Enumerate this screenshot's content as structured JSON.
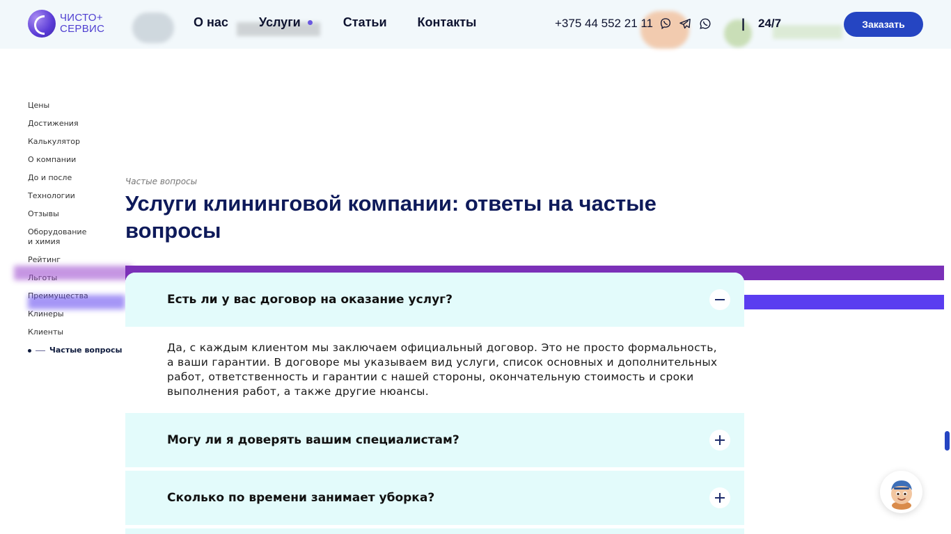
{
  "header": {
    "logo_line1": "ЧИСТО+",
    "logo_line2": "СЕРВИС",
    "nav": [
      {
        "label": "О нас"
      },
      {
        "label": "Услуги"
      },
      {
        "label": "Статьи"
      },
      {
        "label": "Контакты"
      }
    ],
    "phone": "+375 44 552 21 11",
    "separator": "|",
    "hours": "24/7",
    "order_button": "Заказать",
    "social_icons": [
      "viber-icon",
      "telegram-icon",
      "whatsapp-icon"
    ]
  },
  "sidebar": {
    "items": [
      {
        "label": "Цены"
      },
      {
        "label": "Достижения"
      },
      {
        "label": "Калькулятор"
      },
      {
        "label": "О компании"
      },
      {
        "label": "До и после"
      },
      {
        "label": "Технологии"
      },
      {
        "label": "Отзывы"
      },
      {
        "label": "Оборудование и химия"
      },
      {
        "label": "Рейтинг"
      },
      {
        "label": "Льготы"
      },
      {
        "label": "Преимущества"
      },
      {
        "label": "Клинеры"
      },
      {
        "label": "Клиенты"
      },
      {
        "label": "Частые вопросы",
        "active": true
      }
    ]
  },
  "main": {
    "eyebrow": "Частые вопросы",
    "title": "Услуги клининговой компании: ответы на частые вопросы",
    "faq": [
      {
        "question": "Есть ли у вас договор на оказание услуг?",
        "answer": "Да, с каждым клиентом мы заключаем официальный договор. Это не просто формальность, а ваши гарантии. В договоре мы указываем вид услуги, список основных и дополнительных работ, ответственность и гарантии с нашей стороны, окончательную стоимость и сроки выполнения работ, а также другие нюансы.",
        "expanded": true
      },
      {
        "question": "Могу ли я доверять вашим специалистам?",
        "expanded": false
      },
      {
        "question": "Сколько по времени занимает уборка?",
        "expanded": false
      }
    ]
  },
  "colors": {
    "accent": "#2545c2",
    "title": "#0e1a5a",
    "faq_bg": "#e3fbfb",
    "stripe_purple": "#7b30b8",
    "stripe_blue": "#5a3df0"
  }
}
